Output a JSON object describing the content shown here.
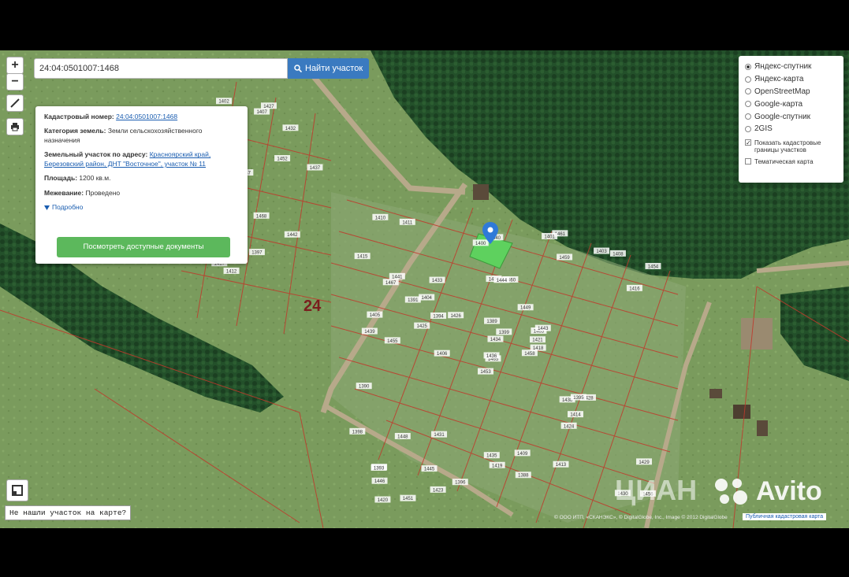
{
  "map": {
    "zoom_in": "+",
    "zoom_out": "−",
    "district_label": "24",
    "region_label": "0501007"
  },
  "search": {
    "value": "24:04:0501007:1468",
    "button_label": "Найти участок"
  },
  "info": {
    "cad_label": "Кадастровый номер:",
    "cad_value": "24:04:0501007:1468",
    "category_label": "Категория земель:",
    "category_value": "Земли сельскохозяйственного назначения",
    "address_label": "Земельный участок по адресу:",
    "address_value": "Красноярский край, Березовский район, ДНТ \"Восточное\", участок № 11",
    "area_label": "Площадь:",
    "area_value": "1200 кв.м.",
    "survey_label": "Межевание:",
    "survey_value": "Проведено",
    "details_label": "Подробно",
    "docs_button": "Посмотреть доступные документы"
  },
  "layers": {
    "options": [
      "Яндекс-спутник",
      "Яндекс-карта",
      "OpenStreetMap",
      "Google-карта",
      "Google-спутник",
      "2GIS"
    ],
    "selected": "Яндекс-спутник",
    "show_cadastral": "Показать кадастровые границы участков",
    "thematic": "Тематическая карта"
  },
  "footer": {
    "not_found": "Не нашли участок на карте?",
    "attribution": "© ООО ИТП, «СКАНЭКС», © DigitalGlobe, Inc., Image © 2012 DigitalGlobe",
    "public_map": "Публичная кадастровая карта"
  },
  "watermark": {
    "avito": "Avito",
    "cian": "ЦИАН"
  },
  "plot_labels": [
    "1468",
    "1467",
    "1465",
    "1464",
    "1463",
    "1462",
    "1461",
    "1460",
    "1459",
    "1458",
    "1457",
    "1456",
    "1455",
    "1454",
    "1453",
    "1452",
    "1451",
    "1450",
    "1449",
    "1448",
    "1447",
    "1446",
    "1445",
    "1444",
    "1443",
    "1442",
    "1441",
    "1440",
    "1439",
    "1438",
    "1437",
    "1436",
    "1435",
    "1434",
    "1433",
    "1432",
    "1431",
    "1430",
    "1429",
    "1428",
    "1427",
    "1426",
    "1425",
    "1424",
    "1423",
    "1422",
    "1421",
    "1420",
    "1419",
    "1418",
    "1417",
    "1416",
    "1415",
    "1414",
    "1413",
    "1412",
    "1411",
    "1410",
    "1409",
    "1408",
    "1407",
    "1406",
    "1405",
    "1404",
    "1403",
    "1402",
    "1401",
    "1400",
    "1399",
    "1398",
    "1397",
    "1396",
    "1395",
    "1394",
    "1393",
    "1392",
    "1391",
    "1390",
    "1389",
    "1388"
  ],
  "colors": {
    "forest": "#1f4a25",
    "field": "#6d8f54",
    "boundary": "#c0392b",
    "selected_plot": "#5ed15e",
    "marker": "#2f7ad8"
  }
}
